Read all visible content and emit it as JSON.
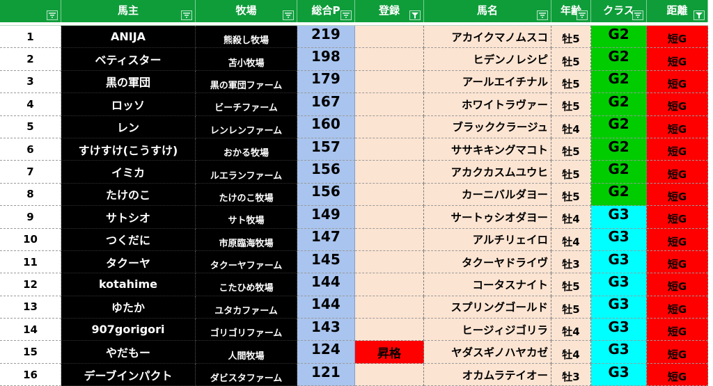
{
  "headers": [
    "",
    "馬主",
    "牧場",
    "総合P",
    "登録",
    "馬名",
    "年齢",
    "クラス",
    "距離"
  ],
  "filter_active_columns": [
    4,
    8
  ],
  "colors": {
    "header_bg": "#0f9d3a",
    "g2": "#00cc00",
    "g3": "#00ffff",
    "distance_bg": "#ff0000",
    "points_bg": "#a9c4ee",
    "peach": "#fce4d2"
  },
  "rows": [
    {
      "no": "1",
      "owner": "ANIJA",
      "farm": "熊殺し牧場",
      "points": "219",
      "reg": "",
      "horse": "アカイクマノムスコ",
      "age": "牡5",
      "class": "G2",
      "distance": "短G"
    },
    {
      "no": "2",
      "owner": "ベティスター",
      "farm": "苫小牧場",
      "points": "198",
      "reg": "",
      "horse": "ヒデンノレシピ",
      "age": "牡5",
      "class": "G2",
      "distance": "短G"
    },
    {
      "no": "3",
      "owner": "黒の軍団",
      "farm": "黒の軍団ファーム",
      "points": "179",
      "reg": "",
      "horse": "アールエイチナル",
      "age": "牡5",
      "class": "G2",
      "distance": "短G"
    },
    {
      "no": "4",
      "owner": "ロッソ",
      "farm": "ビーチファーム",
      "points": "167",
      "reg": "",
      "horse": "ホワイトラヴァー",
      "age": "牡5",
      "class": "G2",
      "distance": "短G"
    },
    {
      "no": "5",
      "owner": "レン",
      "farm": "レンレンファーム",
      "points": "160",
      "reg": "",
      "horse": "ブラッククラージュ",
      "age": "牡4",
      "class": "G2",
      "distance": "短G"
    },
    {
      "no": "6",
      "owner": "すけすけ(こうすけ)",
      "farm": "おかる牧場",
      "points": "157",
      "reg": "",
      "horse": "ササキキングマコト",
      "age": "牡5",
      "class": "G2",
      "distance": "短G"
    },
    {
      "no": "7",
      "owner": "イミカ",
      "farm": "ルエランファーム",
      "points": "156",
      "reg": "",
      "horse": "アカクカスムユウヒ",
      "age": "牡5",
      "class": "G2",
      "distance": "短G"
    },
    {
      "no": "8",
      "owner": "たけのこ",
      "farm": "たけのこ牧場",
      "points": "156",
      "reg": "",
      "horse": "カーニバルダヨー",
      "age": "牡5",
      "class": "G2",
      "distance": "短G"
    },
    {
      "no": "9",
      "owner": "サトシオ",
      "farm": "サト牧場",
      "points": "149",
      "reg": "",
      "horse": "サートゥシオダヨー",
      "age": "牡4",
      "class": "G3",
      "distance": "短G"
    },
    {
      "no": "10",
      "owner": "つくだに",
      "farm": "市原臨海牧場",
      "points": "147",
      "reg": "",
      "horse": "アルチリェイロ",
      "age": "牡4",
      "class": "G3",
      "distance": "短G"
    },
    {
      "no": "11",
      "owner": "タクーヤ",
      "farm": "タクーヤファーム",
      "points": "145",
      "reg": "",
      "horse": "タクーヤドライヴ",
      "age": "牡3",
      "class": "G3",
      "distance": "短G"
    },
    {
      "no": "12",
      "owner": "kotahime",
      "farm": "こたひめ牧場",
      "points": "144",
      "reg": "",
      "horse": "コータスナイト",
      "age": "牡5",
      "class": "G3",
      "distance": "短G"
    },
    {
      "no": "13",
      "owner": "ゆたか",
      "farm": "ユタカファーム",
      "points": "144",
      "reg": "",
      "horse": "スプリングゴールド",
      "age": "牡5",
      "class": "G3",
      "distance": "短G"
    },
    {
      "no": "14",
      "owner": "907gorigori",
      "farm": "ゴリゴリファーム",
      "points": "143",
      "reg": "",
      "horse": "ヒージィジゴリラ",
      "age": "牡4",
      "class": "G3",
      "distance": "短G"
    },
    {
      "no": "15",
      "owner": "やだもー",
      "farm": "人間牧場",
      "points": "124",
      "reg": "昇格",
      "horse": "ヤダスギノハヤカゼ",
      "age": "牡4",
      "class": "G3",
      "distance": "短G"
    },
    {
      "no": "16",
      "owner": "デーブインパクト",
      "farm": "ダビスタファーム",
      "points": "121",
      "reg": "",
      "horse": "オカムラテイオー",
      "age": "牡3",
      "class": "G3",
      "distance": "短G"
    }
  ]
}
